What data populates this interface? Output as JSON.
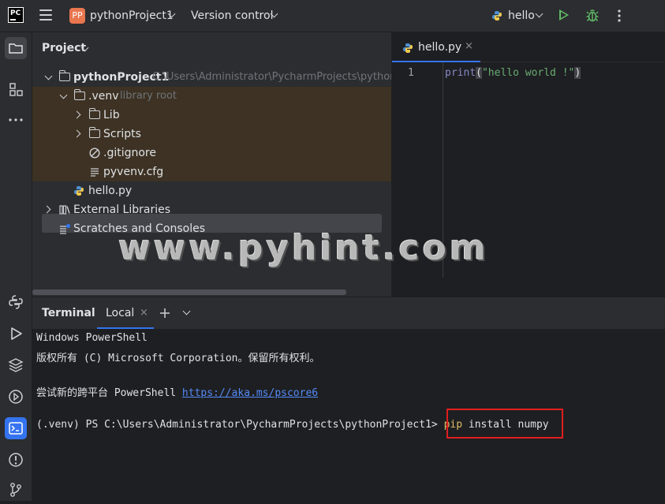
{
  "topbar": {
    "logo_text": "PC",
    "project_badge": "PP",
    "project_name": "pythonProject1",
    "version_control": "Version control",
    "run_config": "hello",
    "icons": [
      "pycharm-logo-icon",
      "hamburger-menu-icon",
      "chevron-down-icon",
      "python-icon",
      "run-icon",
      "debug-icon",
      "more-vertical-icon"
    ]
  },
  "left_toolbar": {
    "icons": [
      "project-folder-icon",
      "structure-icon",
      "more-tools-icon",
      "python-console-icon",
      "run-icon",
      "layers-icon",
      "services-icon",
      "terminal-icon",
      "problems-icon",
      "git-icon"
    ]
  },
  "project_panel": {
    "title": "Project",
    "tree": {
      "root_label": "pythonProject1",
      "root_path": "C:\\Users\\Administrator\\PycharmProjects\\python",
      "venv_label": ".venv",
      "venv_hint": "library root",
      "lib": "Lib",
      "scripts": "Scripts",
      "gitignore": ".gitignore",
      "pyvenv": "pyvenv.cfg",
      "hello": "hello.py",
      "external": "External Libraries",
      "scratches": "Scratches and Consoles"
    }
  },
  "editor": {
    "tab_label": "hello.py",
    "line_number": "1",
    "code": {
      "func": "print",
      "open_paren": "(",
      "string": "\"hello world !\"",
      "close_paren": ")"
    }
  },
  "watermark": "www.pyhint.com",
  "terminal": {
    "title": "Terminal",
    "tab_label": "Local",
    "lines": {
      "l1": "Windows PowerShell",
      "l2": "版权所有 (C) Microsoft Corporation。保留所有权利。",
      "l3_prefix": "尝试新的跨平台 PowerShell ",
      "l3_link": "https://aka.ms/pscore6",
      "prompt": "(.venv) PS C:\\Users\\Administrator\\PycharmProjects\\pythonProject1> ",
      "cmd_keyword": "pip",
      "cmd_rest": " install numpy"
    }
  },
  "colors": {
    "accent": "#3574f0",
    "excluded_bg": "#3d3223",
    "string": "#6aab73",
    "builtin": "#8888c6",
    "cmd_keyword": "#e0bb65",
    "highlight_box": "#e01e1e",
    "run_green": "#5fb865"
  }
}
